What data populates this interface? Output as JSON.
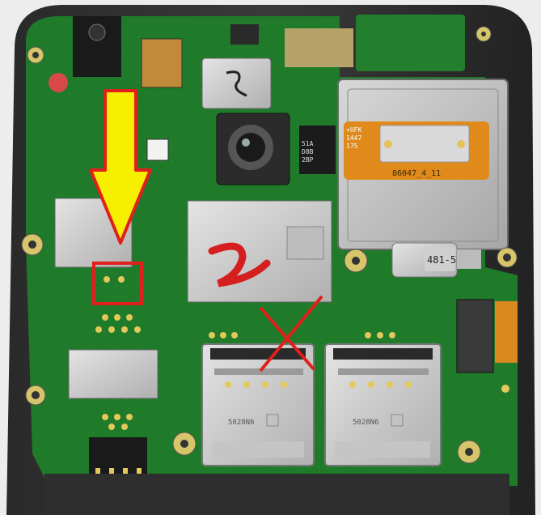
{
  "scene": {
    "connector_text": "86047_4_11",
    "stamp_lines": [
      "+UFK",
      "1447",
      "175"
    ],
    "barcode_lines": [
      "51A",
      "D8B",
      "2BP"
    ],
    "motor_label": "481-5",
    "sim_label_left": "5028N6",
    "sim_label_right": "5028N6"
  },
  "annotations": {
    "arrow_color": "#f7ef00",
    "arrow_outline": "#e0201c",
    "box_color": "#e0201c",
    "cross_color": "#e0201c",
    "shield_mark_color": "#d51f1f"
  }
}
